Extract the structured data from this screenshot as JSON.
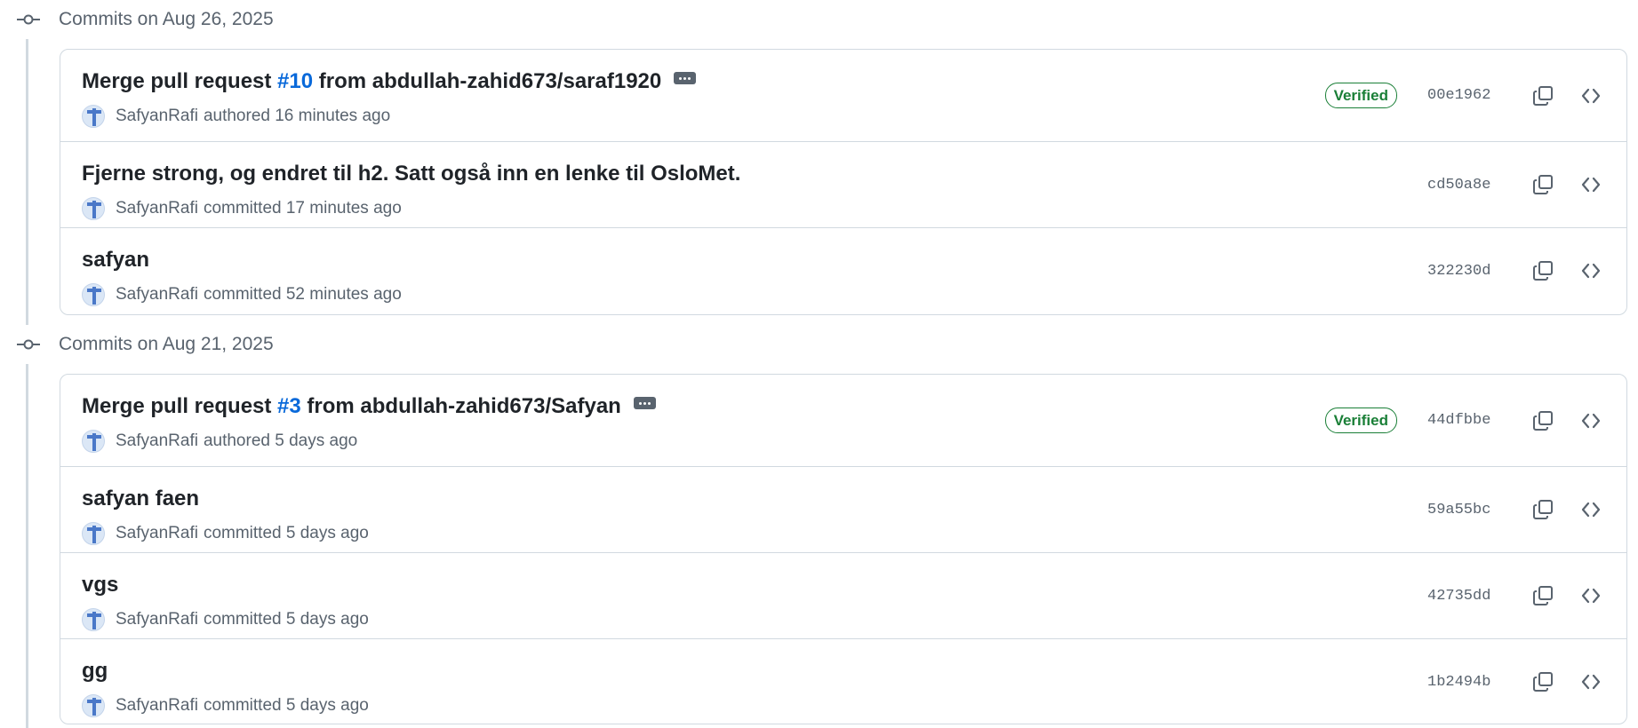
{
  "groups": [
    {
      "title": "Commits on Aug 26, 2025",
      "commits": [
        {
          "title_before": "Merge pull request ",
          "pr_link": "#10",
          "title_after": " from abdullah-zahid673/saraf1920",
          "author": "SafyanRafi",
          "action": "authored 16 minutes ago",
          "verified": "Verified",
          "sha": "00e1962",
          "has_ellipsis": true
        },
        {
          "title": "Fjerne strong, og endret til h2. Satt også inn en lenke til OsloMet.",
          "author": "SafyanRafi",
          "action": "committed 17 minutes ago",
          "sha": "cd50a8e"
        },
        {
          "title": "safyan",
          "author": "SafyanRafi",
          "action": "committed 52 minutes ago",
          "sha": "322230d"
        }
      ]
    },
    {
      "title": "Commits on Aug 21, 2025",
      "commits": [
        {
          "title_before": "Merge pull request ",
          "pr_link": "#3",
          "title_after": " from abdullah-zahid673/Safyan",
          "author": "SafyanRafi",
          "action": "authored 5 days ago",
          "verified": "Verified",
          "sha": "44dfbbe",
          "has_ellipsis": true
        },
        {
          "title": "safyan faen",
          "author": "SafyanRafi",
          "action": "committed 5 days ago",
          "sha": "59a55bc"
        },
        {
          "title": "vgs",
          "author": "SafyanRafi",
          "action": "committed 5 days ago",
          "sha": "42735dd"
        },
        {
          "title": "gg",
          "author": "SafyanRafi",
          "action": "committed 5 days ago",
          "sha": "1b2494b"
        }
      ]
    }
  ],
  "icons": {
    "group": "git-commit-icon",
    "copy": "copy-icon",
    "browse": "code-icon",
    "ellipsis": "kebab-horizontal-icon",
    "avatar": "avatar"
  },
  "colors": {
    "link": "#0969da",
    "verified": "#1a7f37",
    "muted": "#59636e",
    "border": "#d1d9e0"
  }
}
